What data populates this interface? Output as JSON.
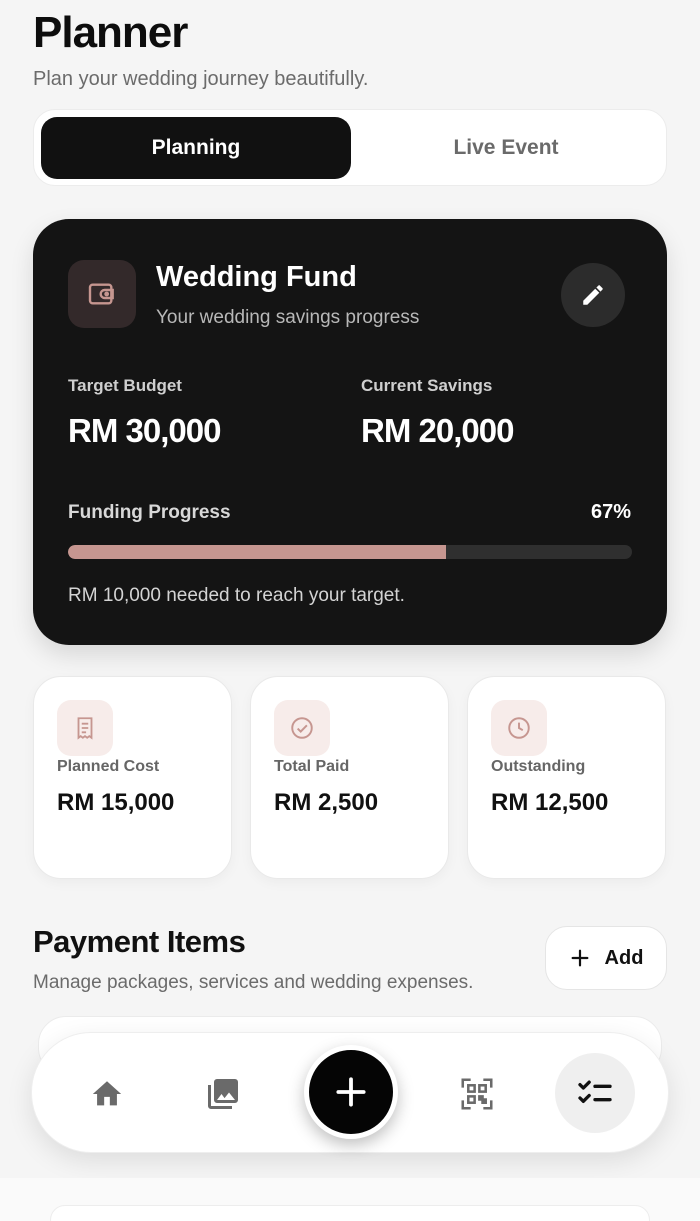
{
  "header": {
    "title": "Planner",
    "subtitle": "Plan your wedding journey beautifully."
  },
  "tabs": [
    {
      "label": "Planning",
      "active": true
    },
    {
      "label": "Live Event",
      "active": false
    }
  ],
  "fund": {
    "title": "Wedding Fund",
    "subtitle": "Your wedding savings progress",
    "icon": "wallet-icon",
    "edit_icon": "pencil-icon",
    "target_label": "Target Budget",
    "target_value": "RM 30,000",
    "savings_label": "Current Savings",
    "savings_value": "RM 20,000",
    "progress_label": "Funding Progress",
    "progress_text": "67%",
    "progress_fraction": 0.67,
    "note": "RM 10,000 needed to reach your target."
  },
  "summary": [
    {
      "label": "Planned Cost",
      "value": "RM 15,000",
      "icon": "receipt-icon"
    },
    {
      "label": "Total Paid",
      "value": "RM 2,500",
      "icon": "check-circle-icon"
    },
    {
      "label": "Outstanding",
      "value": "RM 12,500",
      "icon": "clock-icon"
    }
  ],
  "payments": {
    "title": "Payment Items",
    "subtitle": "Manage packages, services and wedding expenses.",
    "add_label": "Add"
  },
  "nav": {
    "items": [
      "home-icon",
      "gallery-icon",
      "plus-icon",
      "qr-code-icon",
      "checklist-icon"
    ],
    "active": "checklist-icon"
  },
  "colors": {
    "accent": "#c69690",
    "accent_light": "#f7ecea",
    "dark": "#141414"
  }
}
